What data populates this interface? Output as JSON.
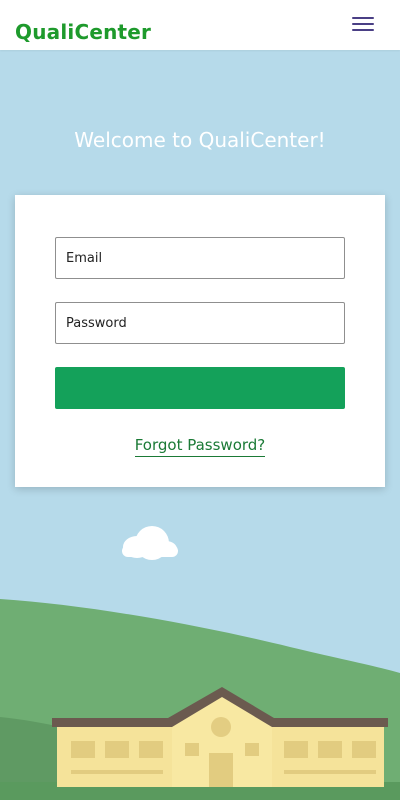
{
  "header": {
    "logo_text": "QualiCenter",
    "menu_icon": "hamburger-menu-icon"
  },
  "main": {
    "welcome_text": "Welcome to QualiCenter!"
  },
  "login_form": {
    "email_placeholder": "Email",
    "password_placeholder": "Password",
    "submit_label": "",
    "forgot_password_label": "Forgot Password?"
  },
  "colors": {
    "brand_green": "#1e9a2c",
    "button_green": "#14a15a",
    "link_green": "#1b7a36",
    "sky": "#b6daea",
    "menu_icon": "#4a3f85"
  }
}
